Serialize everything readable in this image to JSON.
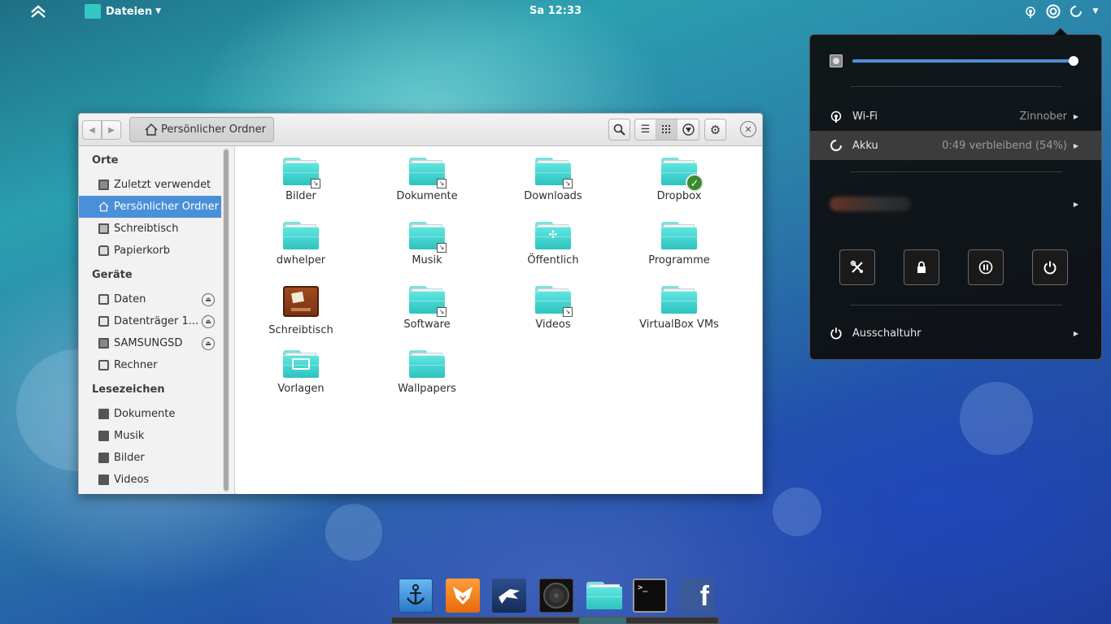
{
  "topbar": {
    "app_menu_label": "Dateien",
    "clock": "Sa 12:33"
  },
  "file_manager": {
    "path_button": "Persönlicher Ordner",
    "sidebar": {
      "places_heading": "Orte",
      "places": [
        {
          "label": "Zuletzt verwendet",
          "icon": "recent-icon"
        },
        {
          "label": "Persönlicher Ordner",
          "icon": "home-icon",
          "selected": true
        },
        {
          "label": "Schreibtisch",
          "icon": "desktop-icon"
        },
        {
          "label": "Papierkorb",
          "icon": "trash-icon"
        }
      ],
      "devices_heading": "Geräte",
      "devices": [
        {
          "label": "Daten",
          "ejectable": true
        },
        {
          "label": "Datenträger 1...",
          "ejectable": true
        },
        {
          "label": "SAMSUNGSD",
          "ejectable": true
        },
        {
          "label": "Rechner",
          "ejectable": false
        }
      ],
      "bookmarks_heading": "Lesezeichen",
      "bookmarks": [
        {
          "label": "Dokumente"
        },
        {
          "label": "Musik"
        },
        {
          "label": "Bilder"
        },
        {
          "label": "Videos"
        }
      ]
    },
    "items": [
      {
        "label": "Bilder",
        "type": "folder",
        "emblem": "link"
      },
      {
        "label": "Dokumente",
        "type": "folder",
        "emblem": "link"
      },
      {
        "label": "Downloads",
        "type": "folder",
        "emblem": "link"
      },
      {
        "label": "Dropbox",
        "type": "folder",
        "emblem": "ok"
      },
      {
        "label": "dwhelper",
        "type": "folder",
        "emblem": ""
      },
      {
        "label": "Musik",
        "type": "folder",
        "emblem": "link"
      },
      {
        "label": "Öffentlich",
        "type": "folder-share",
        "emblem": ""
      },
      {
        "label": "Programme",
        "type": "folder",
        "emblem": ""
      },
      {
        "label": "Schreibtisch",
        "type": "desktop",
        "emblem": ""
      },
      {
        "label": "Software",
        "type": "folder",
        "emblem": "link"
      },
      {
        "label": "Videos",
        "type": "folder",
        "emblem": "link"
      },
      {
        "label": "VirtualBox VMs",
        "type": "folder",
        "emblem": ""
      },
      {
        "label": "Vorlagen",
        "type": "folder-template",
        "emblem": ""
      },
      {
        "label": "Wallpapers",
        "type": "folder",
        "emblem": ""
      }
    ]
  },
  "system_menu": {
    "volume_level": 1.0,
    "wifi_label": "Wi-Fi",
    "wifi_value": "Zinnober",
    "battery_label": "Akku",
    "battery_value": "0:49 verbleibend (54%)",
    "timer_label": "Ausschaltuhr",
    "accent_color": "#4a90d9"
  },
  "dock": {
    "apps": [
      "anchor-app-icon",
      "fox-app-icon",
      "bird-app-icon",
      "speaker-app-icon",
      "files-app-icon",
      "terminal-app-icon",
      "facebook-app-icon"
    ],
    "facebook_glyph": "f",
    "terminal_prompt": ">_"
  }
}
